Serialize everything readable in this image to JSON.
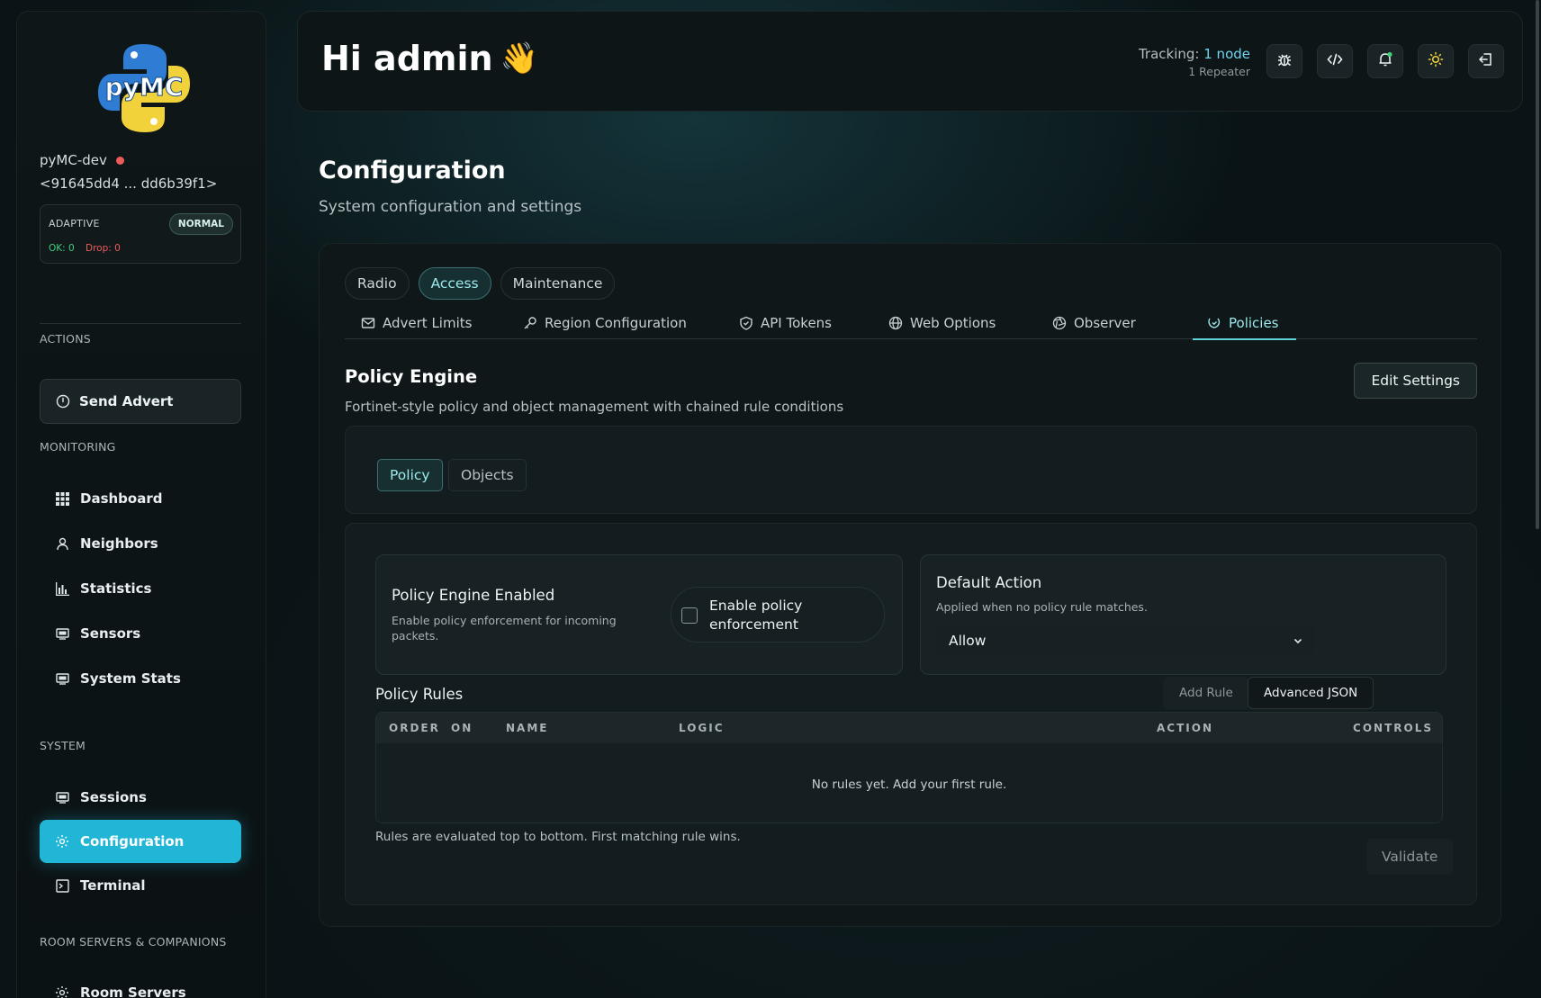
{
  "sidebar": {
    "node_name": "pyMC-dev",
    "node_key": "<91645dd4 ... dd6b39f1>",
    "logo_text": "pyMC",
    "adaptive": {
      "label": "ADAPTIVE",
      "badge": "NORMAL",
      "ok": "OK: 0",
      "drop": "Drop: 0"
    },
    "sections": {
      "actions": "ACTIONS",
      "monitoring": "MONITORING",
      "system": "SYSTEM",
      "room": "ROOM SERVERS & COMPANIONS"
    },
    "send_advert": "Send Advert",
    "items": {
      "dashboard": "Dashboard",
      "neighbors": "Neighbors",
      "statistics": "Statistics",
      "sensors": "Sensors",
      "system_stats": "System Stats",
      "sessions": "Sessions",
      "configuration": "Configuration",
      "terminal": "Terminal",
      "room_servers": "Room Servers"
    }
  },
  "header": {
    "greeting": "Hi admin",
    "wave": "👋",
    "tracking_label": "Tracking:",
    "tracking_value": "1 node",
    "tracking_sub": "1 Repeater",
    "icons": [
      "bug-icon",
      "code-icon",
      "bell-icon",
      "sun-icon",
      "logout-icon"
    ]
  },
  "page": {
    "title": "Configuration",
    "subtitle": "System configuration and settings"
  },
  "tabs": {
    "radio": "Radio",
    "access": "Access",
    "maintenance": "Maintenance"
  },
  "subtabs": {
    "advert_limits": "Advert Limits",
    "region": "Region Configuration",
    "api_tokens": "API Tokens",
    "web_options": "Web Options",
    "observer": "Observer",
    "policies": "Policies"
  },
  "policy_engine": {
    "title": "Policy Engine",
    "subtitle": "Fortinet-style policy and object management with chained rule conditions",
    "edit_button": "Edit Settings",
    "inner_tabs": {
      "policy": "Policy",
      "objects": "Objects"
    },
    "enabled_card": {
      "title": "Policy Engine Enabled",
      "subtitle_line1": "Enable policy enforcement for incoming",
      "subtitle_line2": "packets.",
      "toggle_line1": "Enable policy",
      "toggle_line2": "enforcement",
      "checked": false
    },
    "default_action": {
      "title": "Default Action",
      "subtitle": "Applied when no policy rule matches.",
      "selected": "Allow"
    },
    "rules": {
      "title": "Policy Rules",
      "add_rule": "Add Rule",
      "advanced_json": "Advanced JSON",
      "columns": {
        "order": "ORDER",
        "on": "ON",
        "name": "NAME",
        "logic": "LOGIC",
        "action": "ACTION",
        "controls": "CONTROLS"
      },
      "empty": "No rules yet. Add your first rule.",
      "note": "Rules are evaluated top to bottom. First matching rule wins.",
      "validate": "Validate"
    }
  },
  "colors": {
    "accent": "#22b6d6",
    "tab_active": "#9be9ec",
    "status_error": "#ef5b5b",
    "status_ok": "#3fd07a"
  }
}
